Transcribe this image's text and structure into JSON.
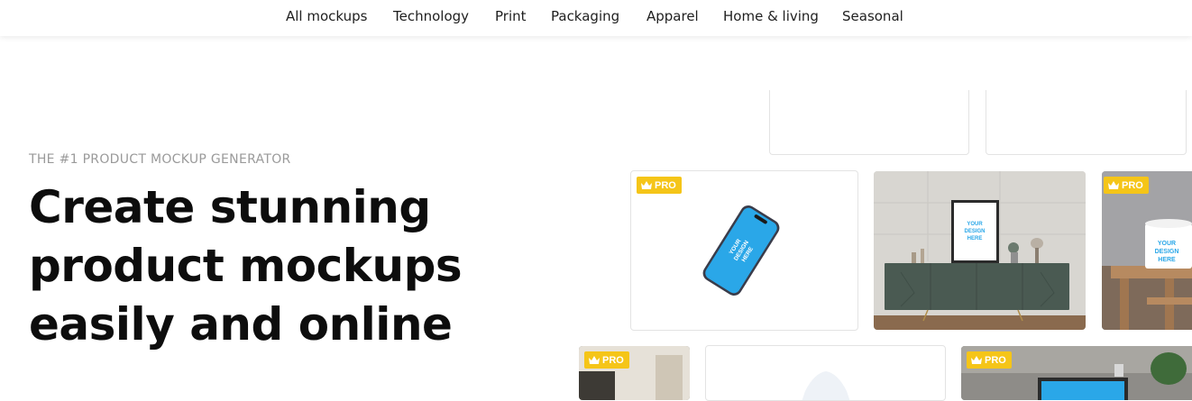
{
  "nav": {
    "items": [
      {
        "label": "All mockups"
      },
      {
        "label": "Technology"
      },
      {
        "label": "Print"
      },
      {
        "label": "Packaging"
      },
      {
        "label": "Apparel"
      },
      {
        "label": "Home & living"
      },
      {
        "label": "Seasonal"
      }
    ]
  },
  "hero": {
    "eyebrow": "THE #1 PRODUCT MOCKUP GENERATOR",
    "headline": "Create stunning product mockups easily and online"
  },
  "badges": {
    "pro": "PRO"
  },
  "mockups": {
    "phone_text": "YOUR DESIGN HERE",
    "frame_text": "YOUR DESIGN HERE",
    "mug_text": "YOUR DESIGN HERE"
  },
  "colors": {
    "pro_badge": "#f5c518",
    "phone_screen": "#2aa7e8",
    "cabinet": "#4a5a52"
  }
}
